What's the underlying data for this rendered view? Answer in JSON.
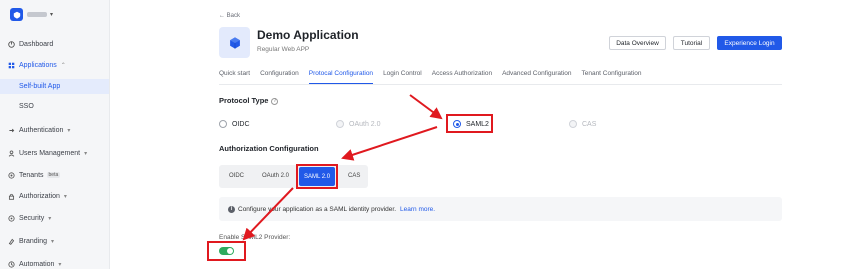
{
  "sidebar": {
    "items": [
      {
        "label": "Dashboard",
        "icon": "dashboard-icon"
      },
      {
        "label": "Applications",
        "icon": "applications-icon",
        "expanded": true
      },
      {
        "label": "Authentication",
        "icon": "authentication-icon"
      },
      {
        "label": "Users Management",
        "icon": "users-icon"
      },
      {
        "label": "Tenants",
        "icon": "tenants-icon",
        "badge": "beta"
      },
      {
        "label": "Authorization",
        "icon": "authorization-icon"
      },
      {
        "label": "Security",
        "icon": "security-icon"
      },
      {
        "label": "Branding",
        "icon": "branding-icon"
      },
      {
        "label": "Automation",
        "icon": "automation-icon"
      }
    ],
    "sub_items": [
      {
        "label": "Self-built App",
        "active": true
      },
      {
        "label": "SSO"
      }
    ]
  },
  "header": {
    "back_label": "← Back",
    "app_title": "Demo Application",
    "app_subtitle": "Regular Web APP",
    "buttons": {
      "data_overview": "Data Overview",
      "tutorial": "Tutorial",
      "experience_login": "Experience Login"
    }
  },
  "tabs": [
    "Quick start",
    "Configuration",
    "Protocal Configuration",
    "Login Control",
    "Access Authorization",
    "Advanced Configuration",
    "Tenant Configuration"
  ],
  "active_tab": "Protocal Configuration",
  "protocol_type": {
    "title": "Protocol Type",
    "options": [
      {
        "label": "OIDC",
        "state": "unchecked"
      },
      {
        "label": "OAuth 2.0",
        "state": "disabled"
      },
      {
        "label": "SAML2",
        "state": "checked"
      },
      {
        "label": "CAS",
        "state": "disabled"
      }
    ]
  },
  "authorization_configuration": {
    "title": "Authorization Configuration",
    "segments": [
      "OIDC",
      "OAuth 2.0",
      "SAML 2.0",
      "CAS"
    ],
    "selected": "SAML 2.0"
  },
  "info": {
    "text": "Configure your application as a SAML identity provider.",
    "link": "Learn more."
  },
  "enable_saml2": {
    "label": "Enable SAML2 Provider:",
    "enabled": true
  },
  "colors": {
    "accent": "#2159e8",
    "toggle_on": "#2eab5e",
    "annotation": "#e0191f"
  }
}
